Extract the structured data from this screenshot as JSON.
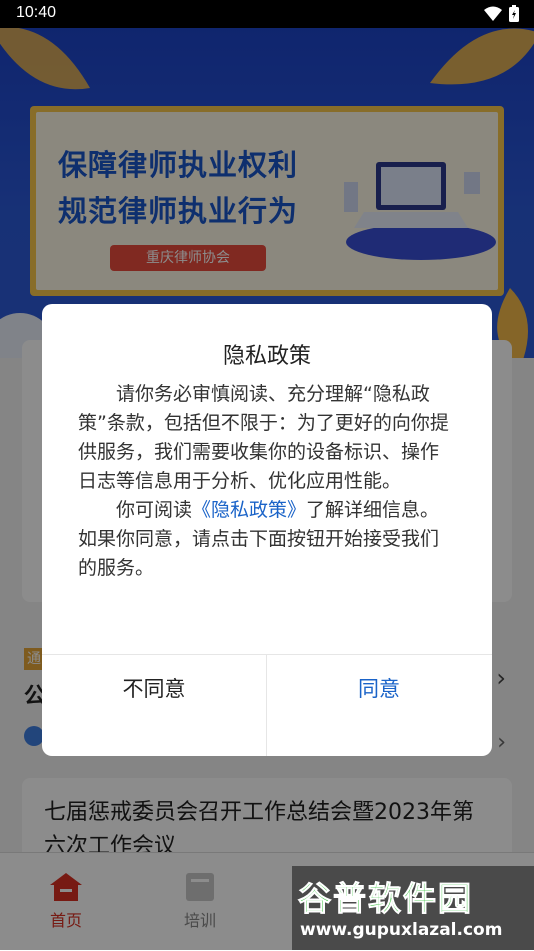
{
  "status_bar": {
    "time": "10:40"
  },
  "banner": {
    "slogan_line1": "保障律师执业权利",
    "slogan_line2": "规范律师执业行为",
    "organization": "重庆律师协会"
  },
  "notice": {
    "tag_char": "通",
    "title_char": "公"
  },
  "news": {
    "item_title": "七届惩戒委员会召开工作总结会暨2023年第六次工作会议"
  },
  "bottom_nav": {
    "items": [
      {
        "label": "首页",
        "icon": "home-icon",
        "active": true
      },
      {
        "label": "培训",
        "icon": "book-icon",
        "active": false
      }
    ]
  },
  "dialog": {
    "title": "隐私政策",
    "paragraph1": "请你务必审慎阅读、充分理解“隐私政策”条款，包括但不限于：为了更好的向你提供服务，我们需要收集你的设备标识、操作日志等信息用于分析、优化应用性能。",
    "paragraph2_prefix": "你可阅读",
    "policy_link": "《隐私政策》",
    "paragraph2_suffix": "了解详细信息。如果你同意，请点击下面按钮开始接受我们的服务。",
    "decline_label": "不同意",
    "agree_label": "同意"
  },
  "watermark": {
    "brand": "谷普软件园",
    "url": "www.gupuxlazal.com"
  },
  "colors": {
    "banner_blue": "#2b59d8",
    "accent_red": "#d93124",
    "link_blue": "#1a63c8",
    "poster_gold": "#f7c64b"
  }
}
